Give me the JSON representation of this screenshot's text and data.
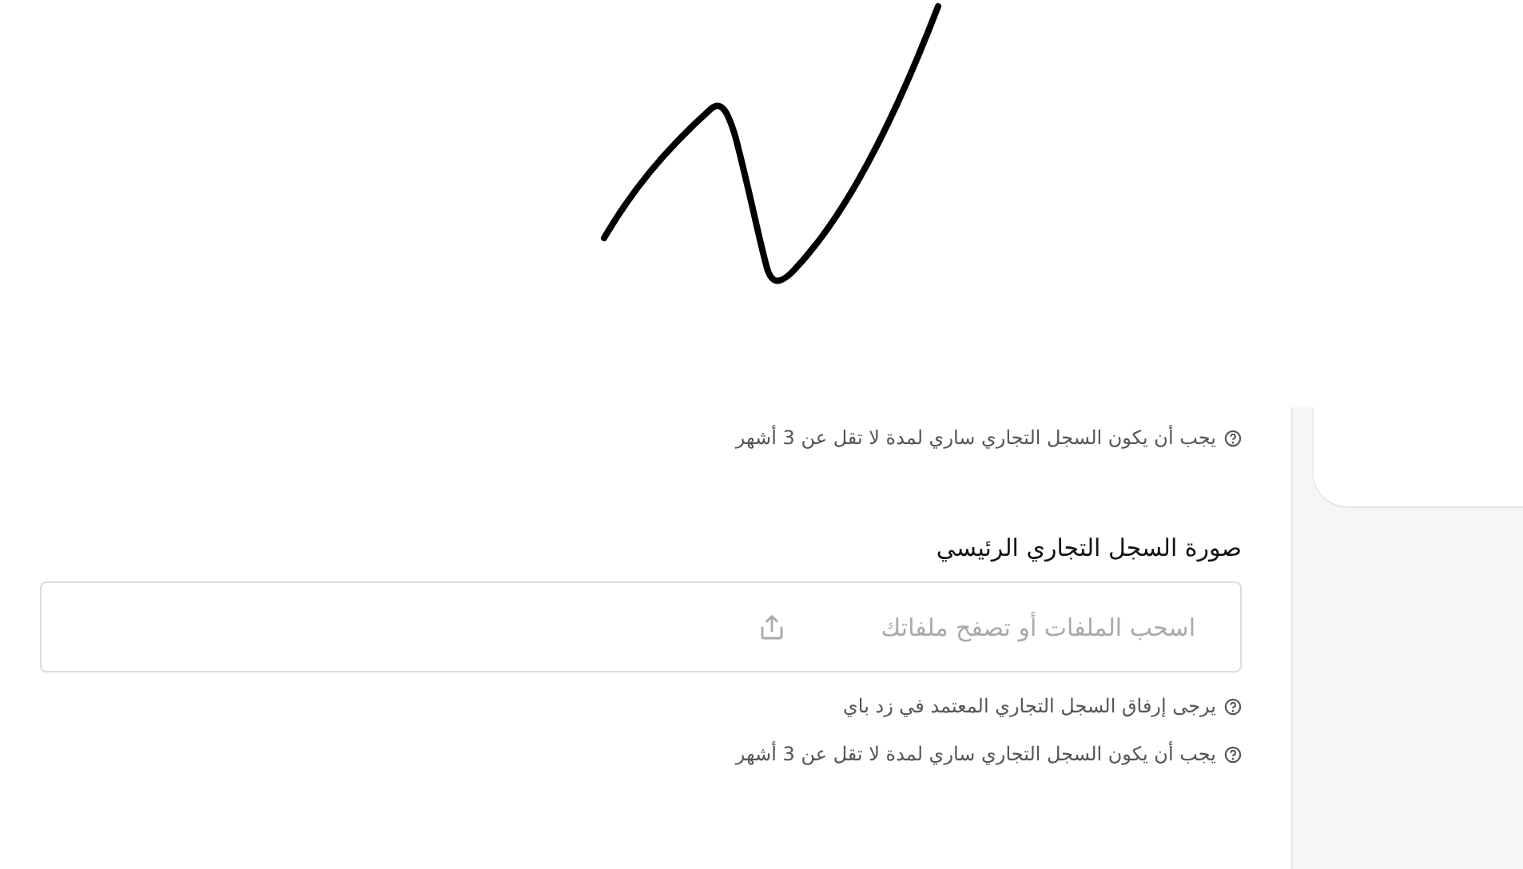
{
  "top_hint": {
    "text": "يجب أن يكون السجل التجاري ساري لمدة لا تقل عن 3 أشهر"
  },
  "upload": {
    "label": "صورة السجل التجاري الرئيسي",
    "placeholder": "اسحب الملفات أو تصفح ملفاتك",
    "hints": [
      "يرجى إرفاق السجل التجاري المعتمد في زد باي",
      "يجب أن يكون السجل التجاري ساري لمدة لا تقل عن 3 أشهر"
    ]
  }
}
